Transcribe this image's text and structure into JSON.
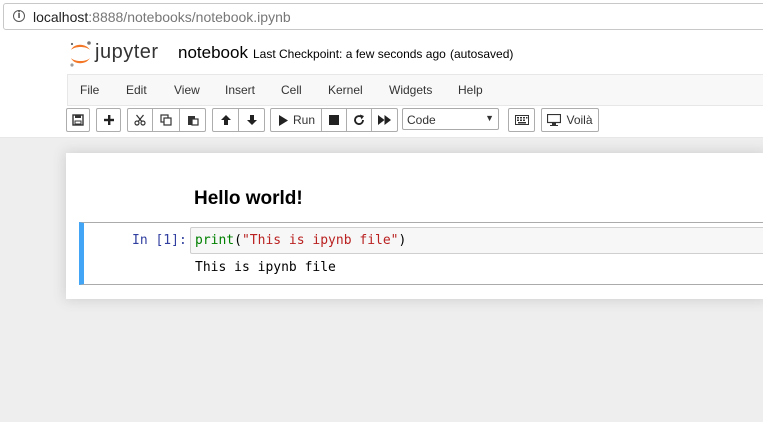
{
  "browser": {
    "url_host": "localhost",
    "url_rest": ":8888/notebooks/notebook.ipynb"
  },
  "header": {
    "logo_text": "jupyter",
    "notebook_name": "notebook",
    "checkpoint": "Last Checkpoint: a few seconds ago",
    "autosave": "(autosaved)"
  },
  "menu": [
    "File",
    "Edit",
    "View",
    "Insert",
    "Cell",
    "Kernel",
    "Widgets",
    "Help"
  ],
  "toolbar": {
    "run_label": "Run",
    "cell_type": "Code",
    "voila_label": "Voilà",
    "icons": [
      "save-icon",
      "plus-icon",
      "scissors-icon",
      "copy-icon",
      "paste-icon",
      "arrow-up-icon",
      "arrow-down-icon",
      "play-icon",
      "stop-icon",
      "restart-icon",
      "fast-forward-icon",
      "keyboard-icon",
      "monitor-icon"
    ]
  },
  "cells": {
    "markdown_heading": "Hello world!",
    "code_prompt": "In [1]:",
    "code_fn": "print",
    "code_open": "(",
    "code_string": "\"This is ipynb file\"",
    "code_close": ")",
    "output": "This is ipynb file"
  },
  "colors": {
    "accent_selected": "#42a5f5",
    "jupyter_orange": "#f37726",
    "prompt_blue": "#303f9f",
    "keyword_green": "#008000",
    "string_red": "#ba2121"
  }
}
